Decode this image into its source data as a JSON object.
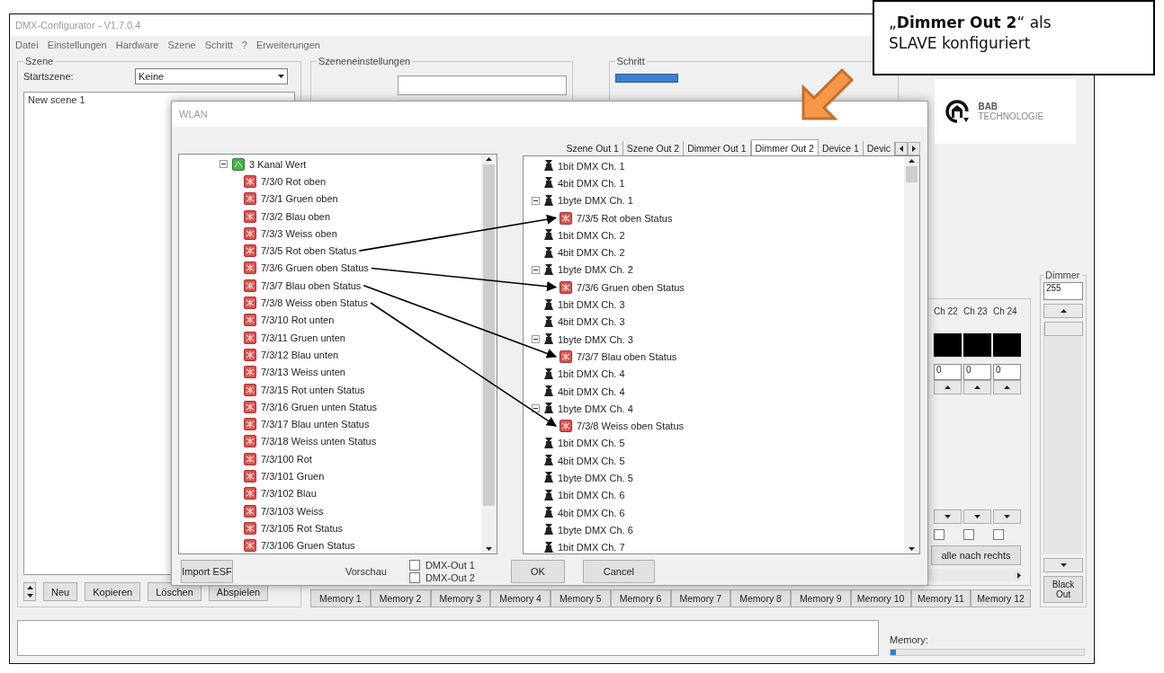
{
  "window": {
    "title": "DMX-Configurator - V1.7.0.4"
  },
  "menu": [
    "Datei",
    "Einstellungen",
    "Hardware",
    "Szene",
    "Schritt",
    "?",
    "Erweiterungen"
  ],
  "scene_panel": {
    "title": "Szene",
    "start_label": "Startszene:",
    "start_value": "Keine",
    "scenes": [
      "New scene 1"
    ],
    "buttons": [
      "Neu",
      "Kopieren",
      "Löschen",
      "Abspielen"
    ]
  },
  "scene_settings": {
    "title": "Szeneneinstellungen"
  },
  "step": {
    "title": "Schritt"
  },
  "logo": {
    "line1": "BAB",
    "line2": "TECHNOLOGIE"
  },
  "channels": [
    {
      "label": "Ch 22",
      "value": "0",
      "checked": false
    },
    {
      "label": "Ch 23",
      "value": "0",
      "checked": false
    },
    {
      "label": "Ch 24",
      "value": "0",
      "checked": false
    }
  ],
  "all_right_button": "alle nach rechts",
  "memory_buttons": [
    "Memory 1",
    "Memory 2",
    "Memory 3",
    "Memory 4",
    "Memory 5",
    "Memory 6",
    "Memory 7",
    "Memory 8",
    "Memory 9",
    "Memory 10",
    "Memory 11",
    "Memory 12"
  ],
  "dimmer": {
    "title": "Dimmer",
    "value": "255",
    "level": 1,
    "button": "Black Out"
  },
  "memory_meter": {
    "label": "Memory:",
    "level": 0.03
  },
  "dialog": {
    "title": "WLAN",
    "source_tree": {
      "label": "3 Kanal Wert",
      "expanded": true,
      "children": [
        {
          "label": "7/3/0 Rot oben",
          "arrow": false
        },
        {
          "label": "7/3/1 Gruen oben",
          "arrow": false
        },
        {
          "label": "7/3/2 Blau oben",
          "arrow": false
        },
        {
          "label": "7/3/3 Weiss oben",
          "arrow": false
        },
        {
          "label": "7/3/5 Rot oben Status",
          "arrow": true
        },
        {
          "label": "7/3/6 Gruen oben Status",
          "arrow": true
        },
        {
          "label": "7/3/7 Blau oben Status",
          "arrow": true
        },
        {
          "label": "7/3/8 Weiss oben Status",
          "arrow": true
        },
        {
          "label": "7/3/10 Rot unten",
          "arrow": false
        },
        {
          "label": "7/3/11 Gruen unten",
          "arrow": false
        },
        {
          "label": "7/3/12 Blau unten",
          "arrow": false
        },
        {
          "label": "7/3/13 Weiss unten",
          "arrow": false
        },
        {
          "label": "7/3/15 Rot unten Status",
          "arrow": false
        },
        {
          "label": "7/3/16 Gruen unten Status",
          "arrow": false
        },
        {
          "label": "7/3/17 Blau unten Status",
          "arrow": false
        },
        {
          "label": "7/3/18 Weiss unten Status",
          "arrow": false
        },
        {
          "label": "7/3/100 Rot",
          "arrow": false
        },
        {
          "label": "7/3/101 Gruen",
          "arrow": false
        },
        {
          "label": "7/3/102 Blau",
          "arrow": false
        },
        {
          "label": "7/3/103 Weiss",
          "arrow": false
        },
        {
          "label": "7/3/105 Rot Status",
          "arrow": false
        },
        {
          "label": "7/3/106 Gruen Status",
          "arrow": false
        }
      ]
    },
    "tabs": [
      {
        "label": "Szene Out 1",
        "selected": false
      },
      {
        "label": "Szene Out 2",
        "selected": false
      },
      {
        "label": "Dimmer Out 1",
        "selected": false
      },
      {
        "label": "Dimmer Out 2",
        "selected": true
      },
      {
        "label": "Device 1",
        "selected": false
      },
      {
        "label": "Devic",
        "selected": false
      }
    ],
    "target_tree": [
      {
        "label": "1bit DMX Ch. 1"
      },
      {
        "label": "4bit DMX Ch. 1"
      },
      {
        "label": "1byte DMX Ch. 1",
        "expanded": true,
        "children": [
          {
            "label": "7/3/5 Rot oben Status",
            "arrow": true
          }
        ]
      },
      {
        "label": "1bit DMX Ch. 2"
      },
      {
        "label": "4bit DMX Ch. 2"
      },
      {
        "label": "1byte DMX Ch. 2",
        "expanded": true,
        "children": [
          {
            "label": "7/3/6 Gruen oben Status",
            "arrow": true
          }
        ]
      },
      {
        "label": "1bit DMX Ch. 3"
      },
      {
        "label": "4bit DMX Ch. 3"
      },
      {
        "label": "1byte DMX Ch. 3",
        "expanded": true,
        "children": [
          {
            "label": "7/3/7 Blau oben Status",
            "arrow": true
          }
        ]
      },
      {
        "label": "1bit DMX Ch. 4"
      },
      {
        "label": "4bit DMX Ch. 4"
      },
      {
        "label": "1byte DMX Ch. 4",
        "expanded": true,
        "children": [
          {
            "label": "7/3/8 Weiss oben Status",
            "arrow": true
          }
        ]
      },
      {
        "label": "1bit DMX Ch. 5"
      },
      {
        "label": "4bit DMX Ch. 5"
      },
      {
        "label": "1byte DMX Ch. 5"
      },
      {
        "label": "1bit DMX Ch. 6"
      },
      {
        "label": "4bit DMX Ch. 6"
      },
      {
        "label": "1byte DMX Ch. 6"
      },
      {
        "label": "1bit DMX Ch. 7"
      }
    ],
    "import_button": "Import ESF",
    "preview_label": "Vorschau",
    "preview_outputs": [
      {
        "label": "DMX-Out 1",
        "checked": false
      },
      {
        "label": "DMX-Out 2",
        "checked": false
      }
    ],
    "ok_button": "OK",
    "cancel_button": "Cancel"
  },
  "callout": "„**Dimmer Out 2**“ als SLAVE konfiguriert"
}
